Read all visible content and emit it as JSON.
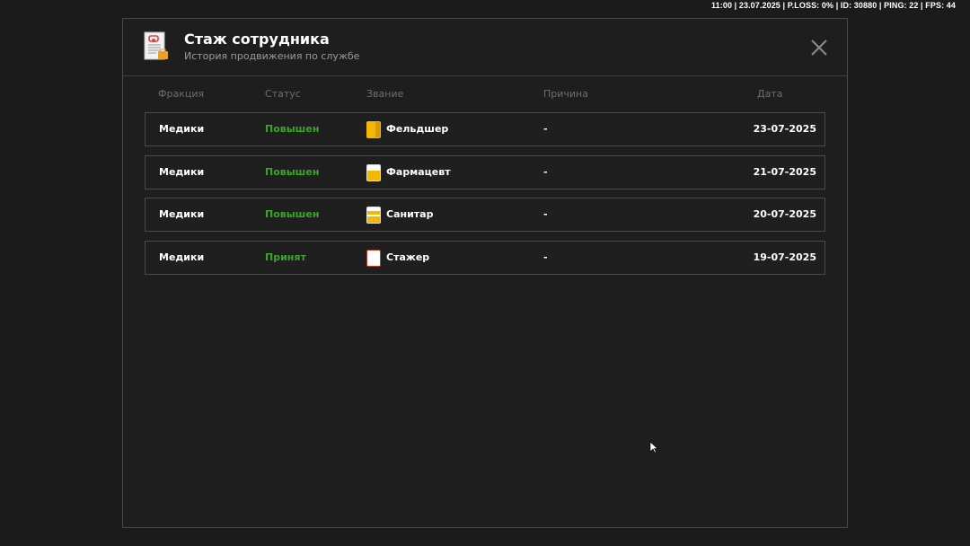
{
  "status_bar": "11:00 | 23.07.2025 | P.LOSS: 0% | ID: 30880 | PING: 22 | FPS: 44",
  "modal": {
    "title": "Стаж сотрудника",
    "subtitle": "История продвижения по службе"
  },
  "columns": {
    "faction": "Фракция",
    "status": "Статус",
    "rank": "Звание",
    "reason": "Причина",
    "date": "Дата"
  },
  "rows": [
    {
      "faction": "Медики",
      "status": "Повышен",
      "rank": "Фельдшер",
      "rank_icon": "rank-full-yellow-icon",
      "reason": "-",
      "date": "23-07-2025"
    },
    {
      "faction": "Медики",
      "status": "Повышен",
      "rank": "Фармацевт",
      "rank_icon": "rank-half-yellow-icon",
      "reason": "-",
      "date": "21-07-2025"
    },
    {
      "faction": "Медики",
      "status": "Повышен",
      "rank": "Санитар",
      "rank_icon": "rank-partial-yellow-icon",
      "reason": "-",
      "date": "20-07-2025"
    },
    {
      "faction": "Медики",
      "status": "Принят",
      "rank": "Стажер",
      "rank_icon": "rank-empty-icon",
      "reason": "-",
      "date": "19-07-2025"
    }
  ],
  "colors": {
    "status_green": "#3aa52a",
    "rank_yellow": "#f5b800",
    "background": "#1b1b1b"
  }
}
